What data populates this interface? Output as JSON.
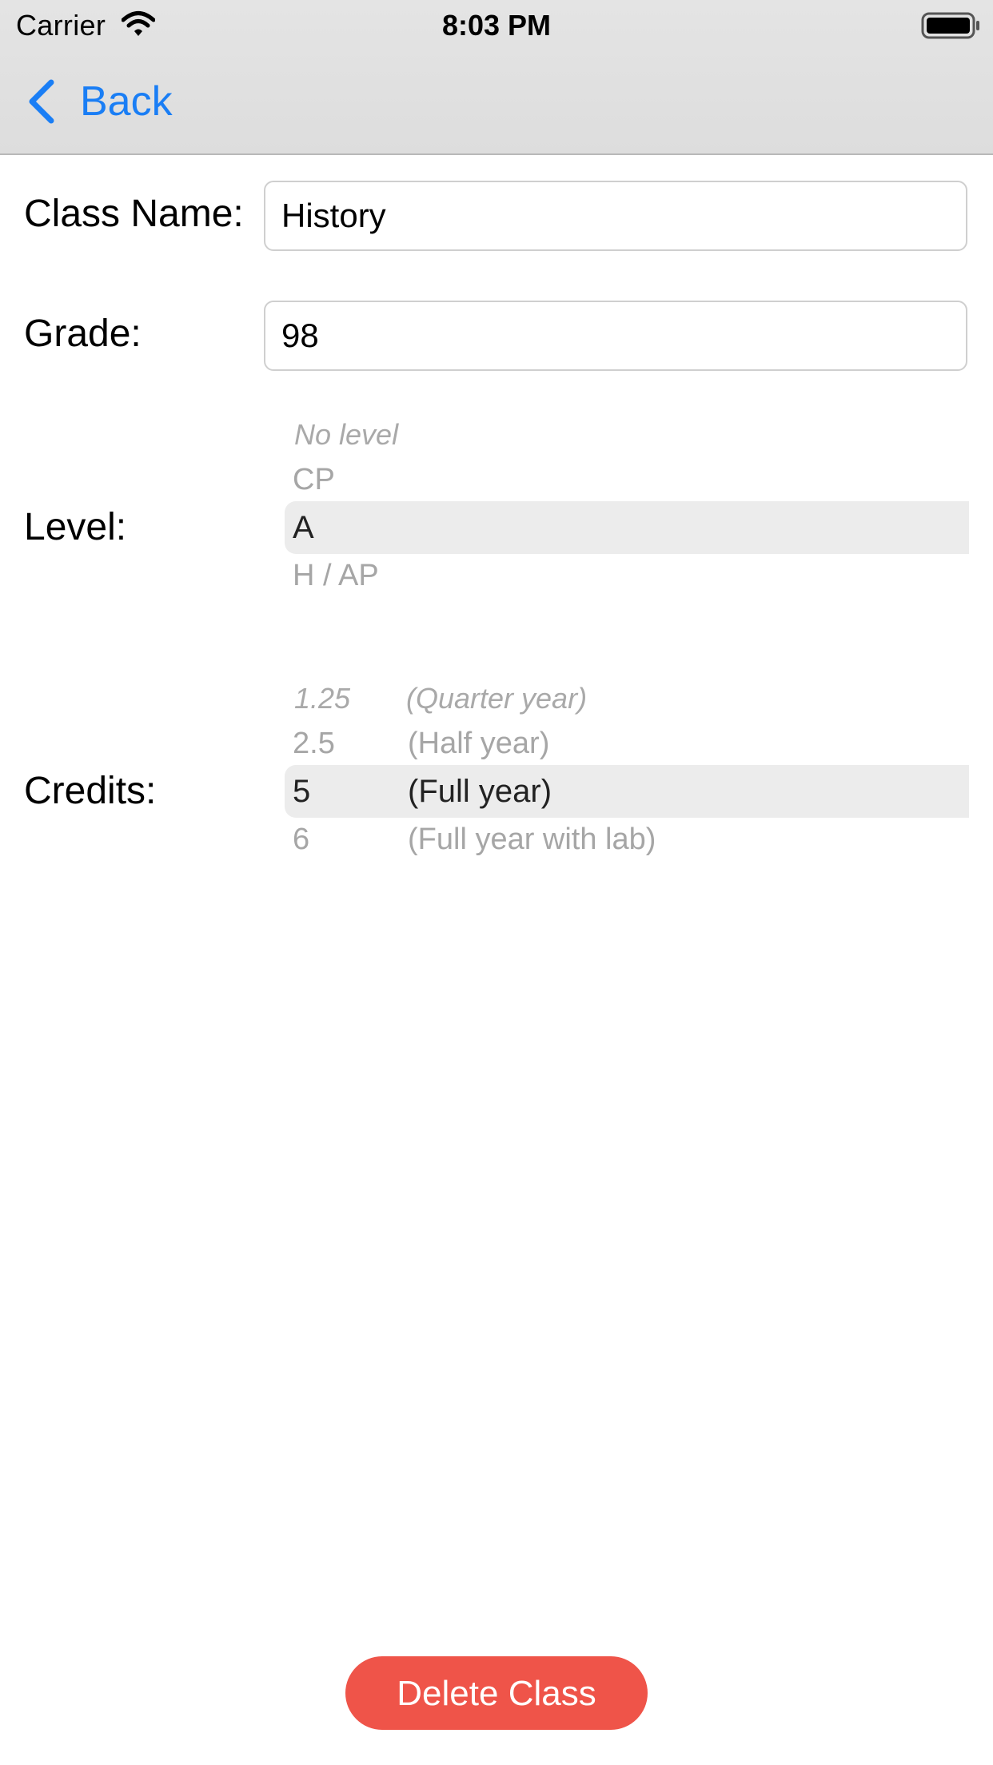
{
  "status_bar": {
    "carrier": "Carrier",
    "time": "8:03 PM",
    "wifi_icon": "wifi-icon",
    "battery_icon": "battery-icon"
  },
  "nav": {
    "back_label": "Back",
    "back_icon": "chevron-left-icon",
    "accent_color": "#1a7ef5"
  },
  "form": {
    "class_name": {
      "label": "Class Name:",
      "value": "History"
    },
    "grade": {
      "label": "Grade:",
      "value": "98"
    },
    "level": {
      "label": "Level:",
      "options": [
        "No level",
        "CP",
        "A",
        "H / AP"
      ],
      "selected": "A"
    },
    "credits": {
      "label": "Credits:",
      "options": [
        {
          "value": "1.25",
          "description": "(Quarter year)"
        },
        {
          "value": "2.5",
          "description": "(Half year)"
        },
        {
          "value": "5",
          "description": "(Full year)"
        },
        {
          "value": "6",
          "description": "(Full year with lab)"
        }
      ],
      "selected": "5"
    }
  },
  "actions": {
    "delete_label": "Delete Class",
    "delete_color": "#ef5449"
  }
}
